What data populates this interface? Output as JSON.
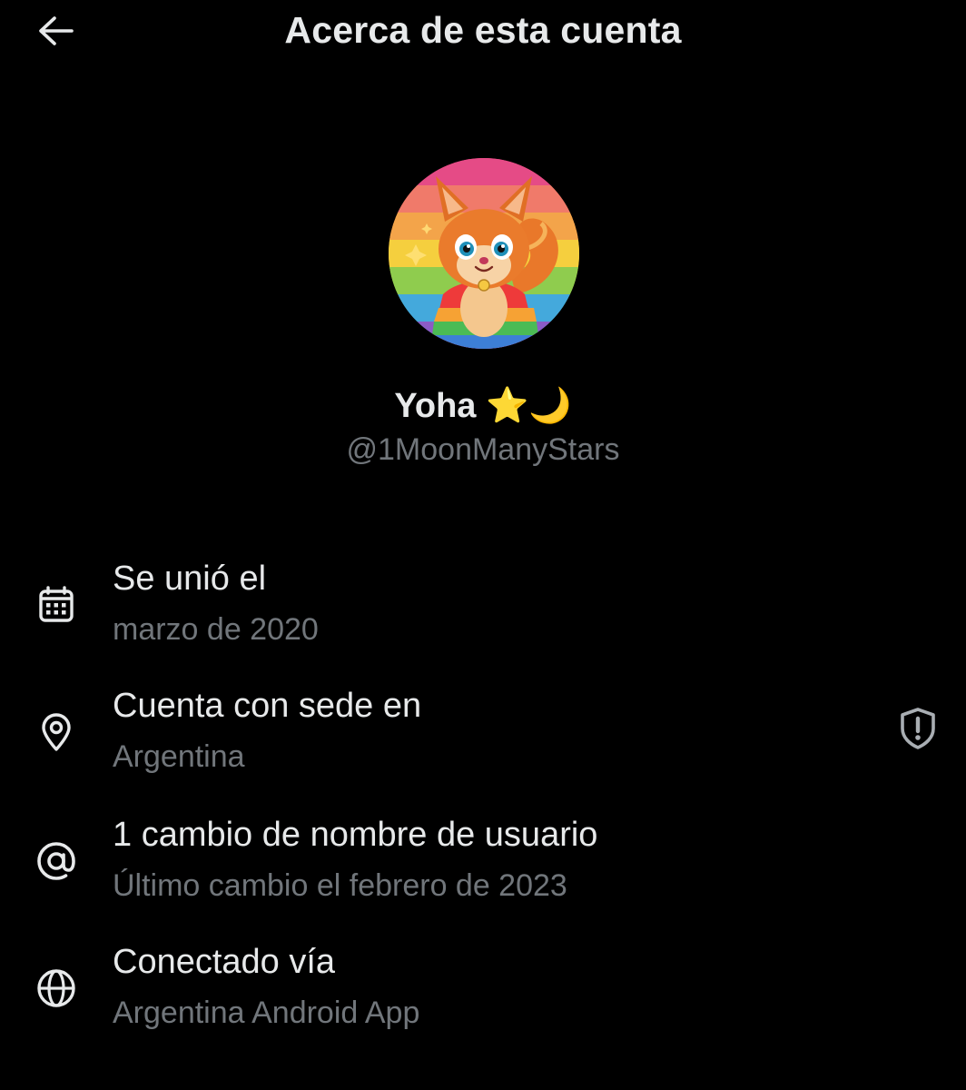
{
  "header": {
    "back_icon": "arrow-left-icon",
    "title": "Acerca de esta cuenta"
  },
  "profile": {
    "avatar": "squirrel-rainbow-avatar",
    "name": "Yoha",
    "name_emoji_star": "⭐",
    "name_emoji_moon": "🌙",
    "handle": "@1MoonManyStars"
  },
  "details": [
    {
      "icon": "calendar-icon",
      "label": "Se unió el",
      "value": "marzo de 2020"
    },
    {
      "icon": "location-pin-icon",
      "label": "Cuenta con sede en",
      "value": "Argentina",
      "action_icon": "shield-alert-icon"
    },
    {
      "icon": "at-sign-icon",
      "label": "1 cambio de nombre de usuario",
      "value": "Último cambio el febrero de 2023"
    },
    {
      "icon": "globe-icon",
      "label": "Conectado vía",
      "value": "Argentina Android App"
    }
  ],
  "colors": {
    "background": "#000000",
    "primary_text": "#e7e9ea",
    "secondary_text": "#71767b"
  }
}
